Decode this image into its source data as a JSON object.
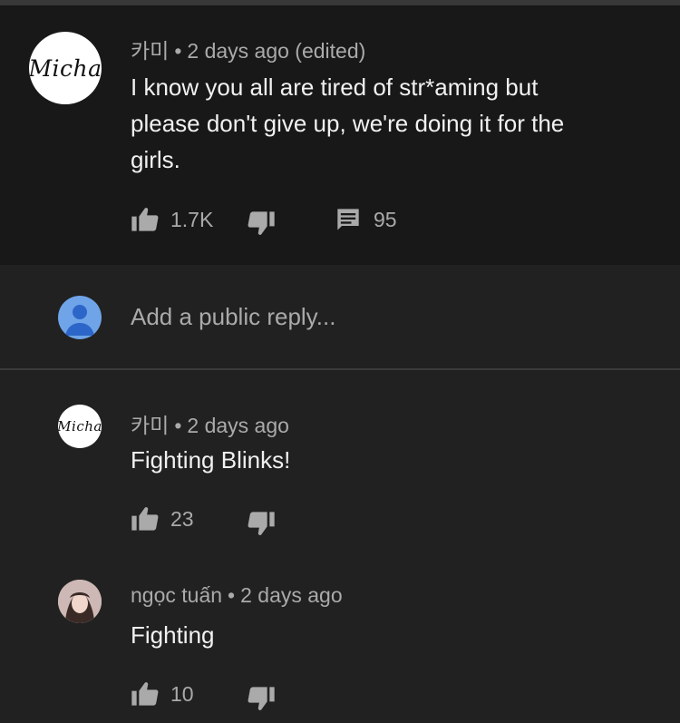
{
  "main_comment": {
    "author": "카미",
    "time": "2 days ago (edited)",
    "avatar_text": "Micha",
    "lines": [
      "I know you all are tired of str*aming but",
      "please don't give up, we're doing it for the",
      "girls."
    ],
    "likes": "1.7K",
    "replies_count": "95"
  },
  "reply_box": {
    "placeholder": "Add a public reply..."
  },
  "replies": [
    {
      "author": "카미",
      "time": "2 days ago",
      "avatar_text": "Micha",
      "text": "Fighting Blinks!",
      "likes": "23"
    },
    {
      "author": "ngọc tuấn",
      "time": "2 days ago",
      "text": "Fighting",
      "likes": "10"
    }
  ],
  "colors": {
    "background": "#212121",
    "highlight": "#181818",
    "secondary_text": "#aaaaaa",
    "avatar_blue": "#6fa4e8"
  },
  "icons": [
    "like-icon",
    "dislike-icon",
    "reply-count-icon",
    "user-avatar-icon"
  ]
}
